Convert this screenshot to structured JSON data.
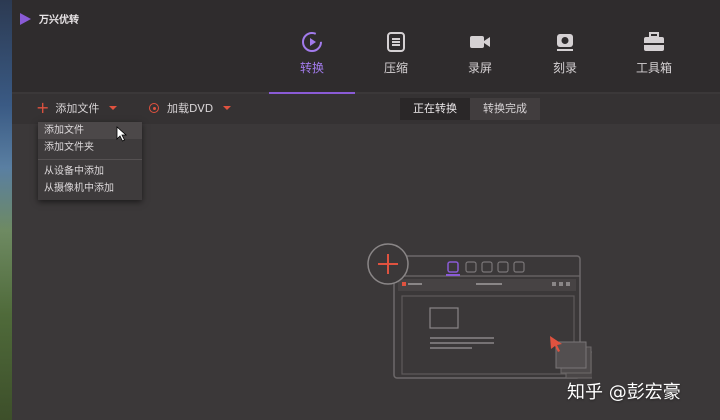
{
  "app": {
    "title": "万兴优转",
    "accent": "#8a5bd6",
    "action_color": "#e0523f"
  },
  "nav": [
    {
      "label": "转换",
      "icon": "convert-icon",
      "active": true
    },
    {
      "label": "压缩",
      "icon": "compress-icon",
      "active": false
    },
    {
      "label": "录屏",
      "icon": "record-screen-icon",
      "active": false
    },
    {
      "label": "刻录",
      "icon": "burn-disc-icon",
      "active": false
    },
    {
      "label": "工具箱",
      "icon": "toolbox-icon",
      "active": false
    }
  ],
  "toolbar": {
    "add_file": "添加文件",
    "load_dvd": "加载DVD",
    "tabs": [
      {
        "label": "正在转换",
        "active": true
      },
      {
        "label": "转换完成",
        "active": false
      }
    ]
  },
  "dropdown": {
    "items": [
      "添加文件",
      "添加文件夹",
      "从设备中添加",
      "从摄像机中添加"
    ]
  },
  "watermark": "知乎 @彭宏豪"
}
